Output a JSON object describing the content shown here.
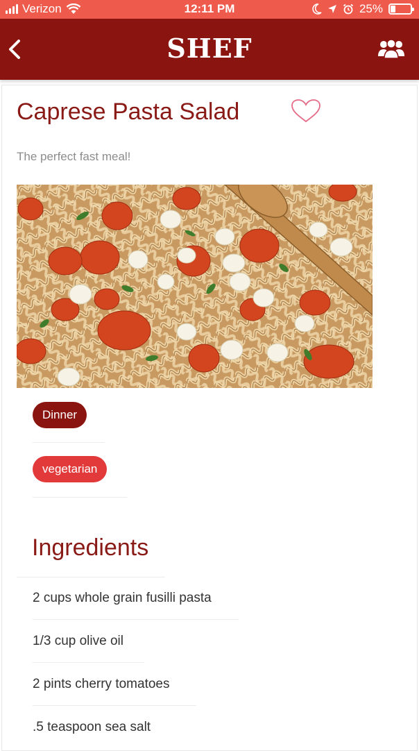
{
  "status": {
    "carrier": "Verizon",
    "time": "12:11 PM",
    "battery": "25%",
    "battery_level": 0.25
  },
  "nav": {
    "title": "SHEF",
    "back_icon": "chevron-left-icon",
    "people_icon": "group-icon"
  },
  "recipe": {
    "title": "Caprese Pasta Salad",
    "subtitle": "The perfect fast meal!",
    "favorite_icon": "heart-outline-icon",
    "tags": [
      "Dinner",
      "vegetarian"
    ]
  },
  "ingredients": {
    "heading": "Ingredients",
    "items": [
      "2 cups whole grain fusilli pasta",
      "1/3 cup olive oil",
      "2 pints cherry tomatoes",
      ".5 teaspoon sea salt"
    ]
  },
  "colors": {
    "status_bar": "#ee5a4c",
    "nav_bar": "#8a1510",
    "accent": "#8a1a16",
    "tag_secondary": "#e23a3a"
  }
}
